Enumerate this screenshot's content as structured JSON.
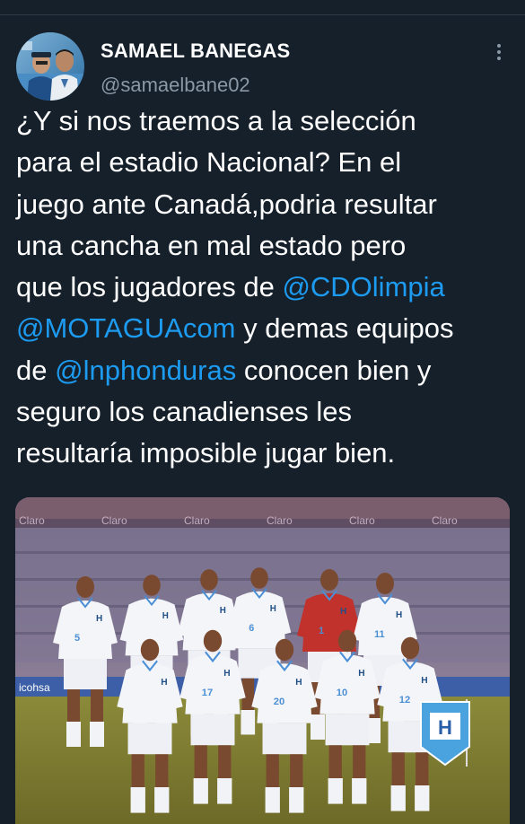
{
  "author": {
    "display_name": "SAMAEL BANEGAS",
    "handle": "@samaelbane02",
    "avatar_icon": "user-avatar-photo"
  },
  "menu": {
    "icon": "more-vertical-icon"
  },
  "tweet": {
    "lines": [
      [
        {
          "text": "¿Y si nos traemos a la selección"
        }
      ],
      [
        {
          "text": "para el estadio Nacional? En el"
        }
      ],
      [
        {
          "text": "juego ante Canadá,podria resultar"
        }
      ],
      [
        {
          "text": "una cancha en mal estado pero"
        }
      ],
      [
        {
          "text": "que los jugadores de "
        },
        {
          "text": "@CDOlimpia",
          "mention": true
        }
      ],
      [
        {
          "text": "@MOTAGUAcom",
          "mention": true
        },
        {
          "text": " y demas equipos"
        }
      ],
      [
        {
          "text": "de "
        },
        {
          "text": "@lnphonduras",
          "mention": true
        },
        {
          "text": " conocen bien y"
        }
      ],
      [
        {
          "text": "seguro los canadienses les"
        }
      ],
      [
        {
          "text": "resultaría imposible jugar bien."
        }
      ]
    ]
  },
  "media": {
    "banner_texts": [
      "Claro",
      "Claro",
      "Claro",
      "Claro",
      "Claro",
      "Claro"
    ],
    "ad_board_text": "icohsa",
    "pennant_letter": "H",
    "players": [
      {
        "shirt": "H",
        "number": "5"
      },
      {
        "shirt": "H",
        "number": ""
      },
      {
        "shirt": "H",
        "number": ""
      },
      {
        "shirt": "H",
        "number": "6"
      },
      {
        "shirt": "H",
        "number": "1"
      },
      {
        "shirt": "H",
        "number": "11"
      },
      {
        "shirt": "H",
        "number": ""
      },
      {
        "shirt": "H",
        "number": "17"
      },
      {
        "shirt": "H",
        "number": "20"
      },
      {
        "shirt": "H",
        "number": "10"
      },
      {
        "shirt": "H",
        "number": "12"
      }
    ]
  },
  "colors": {
    "background": "#15202b",
    "text_primary": "#ffffff",
    "text_secondary": "#8b98a5",
    "mention": "#1d9bf0",
    "goalkeeper_kit": "#c1322c",
    "kit": "#f4f5f8"
  }
}
